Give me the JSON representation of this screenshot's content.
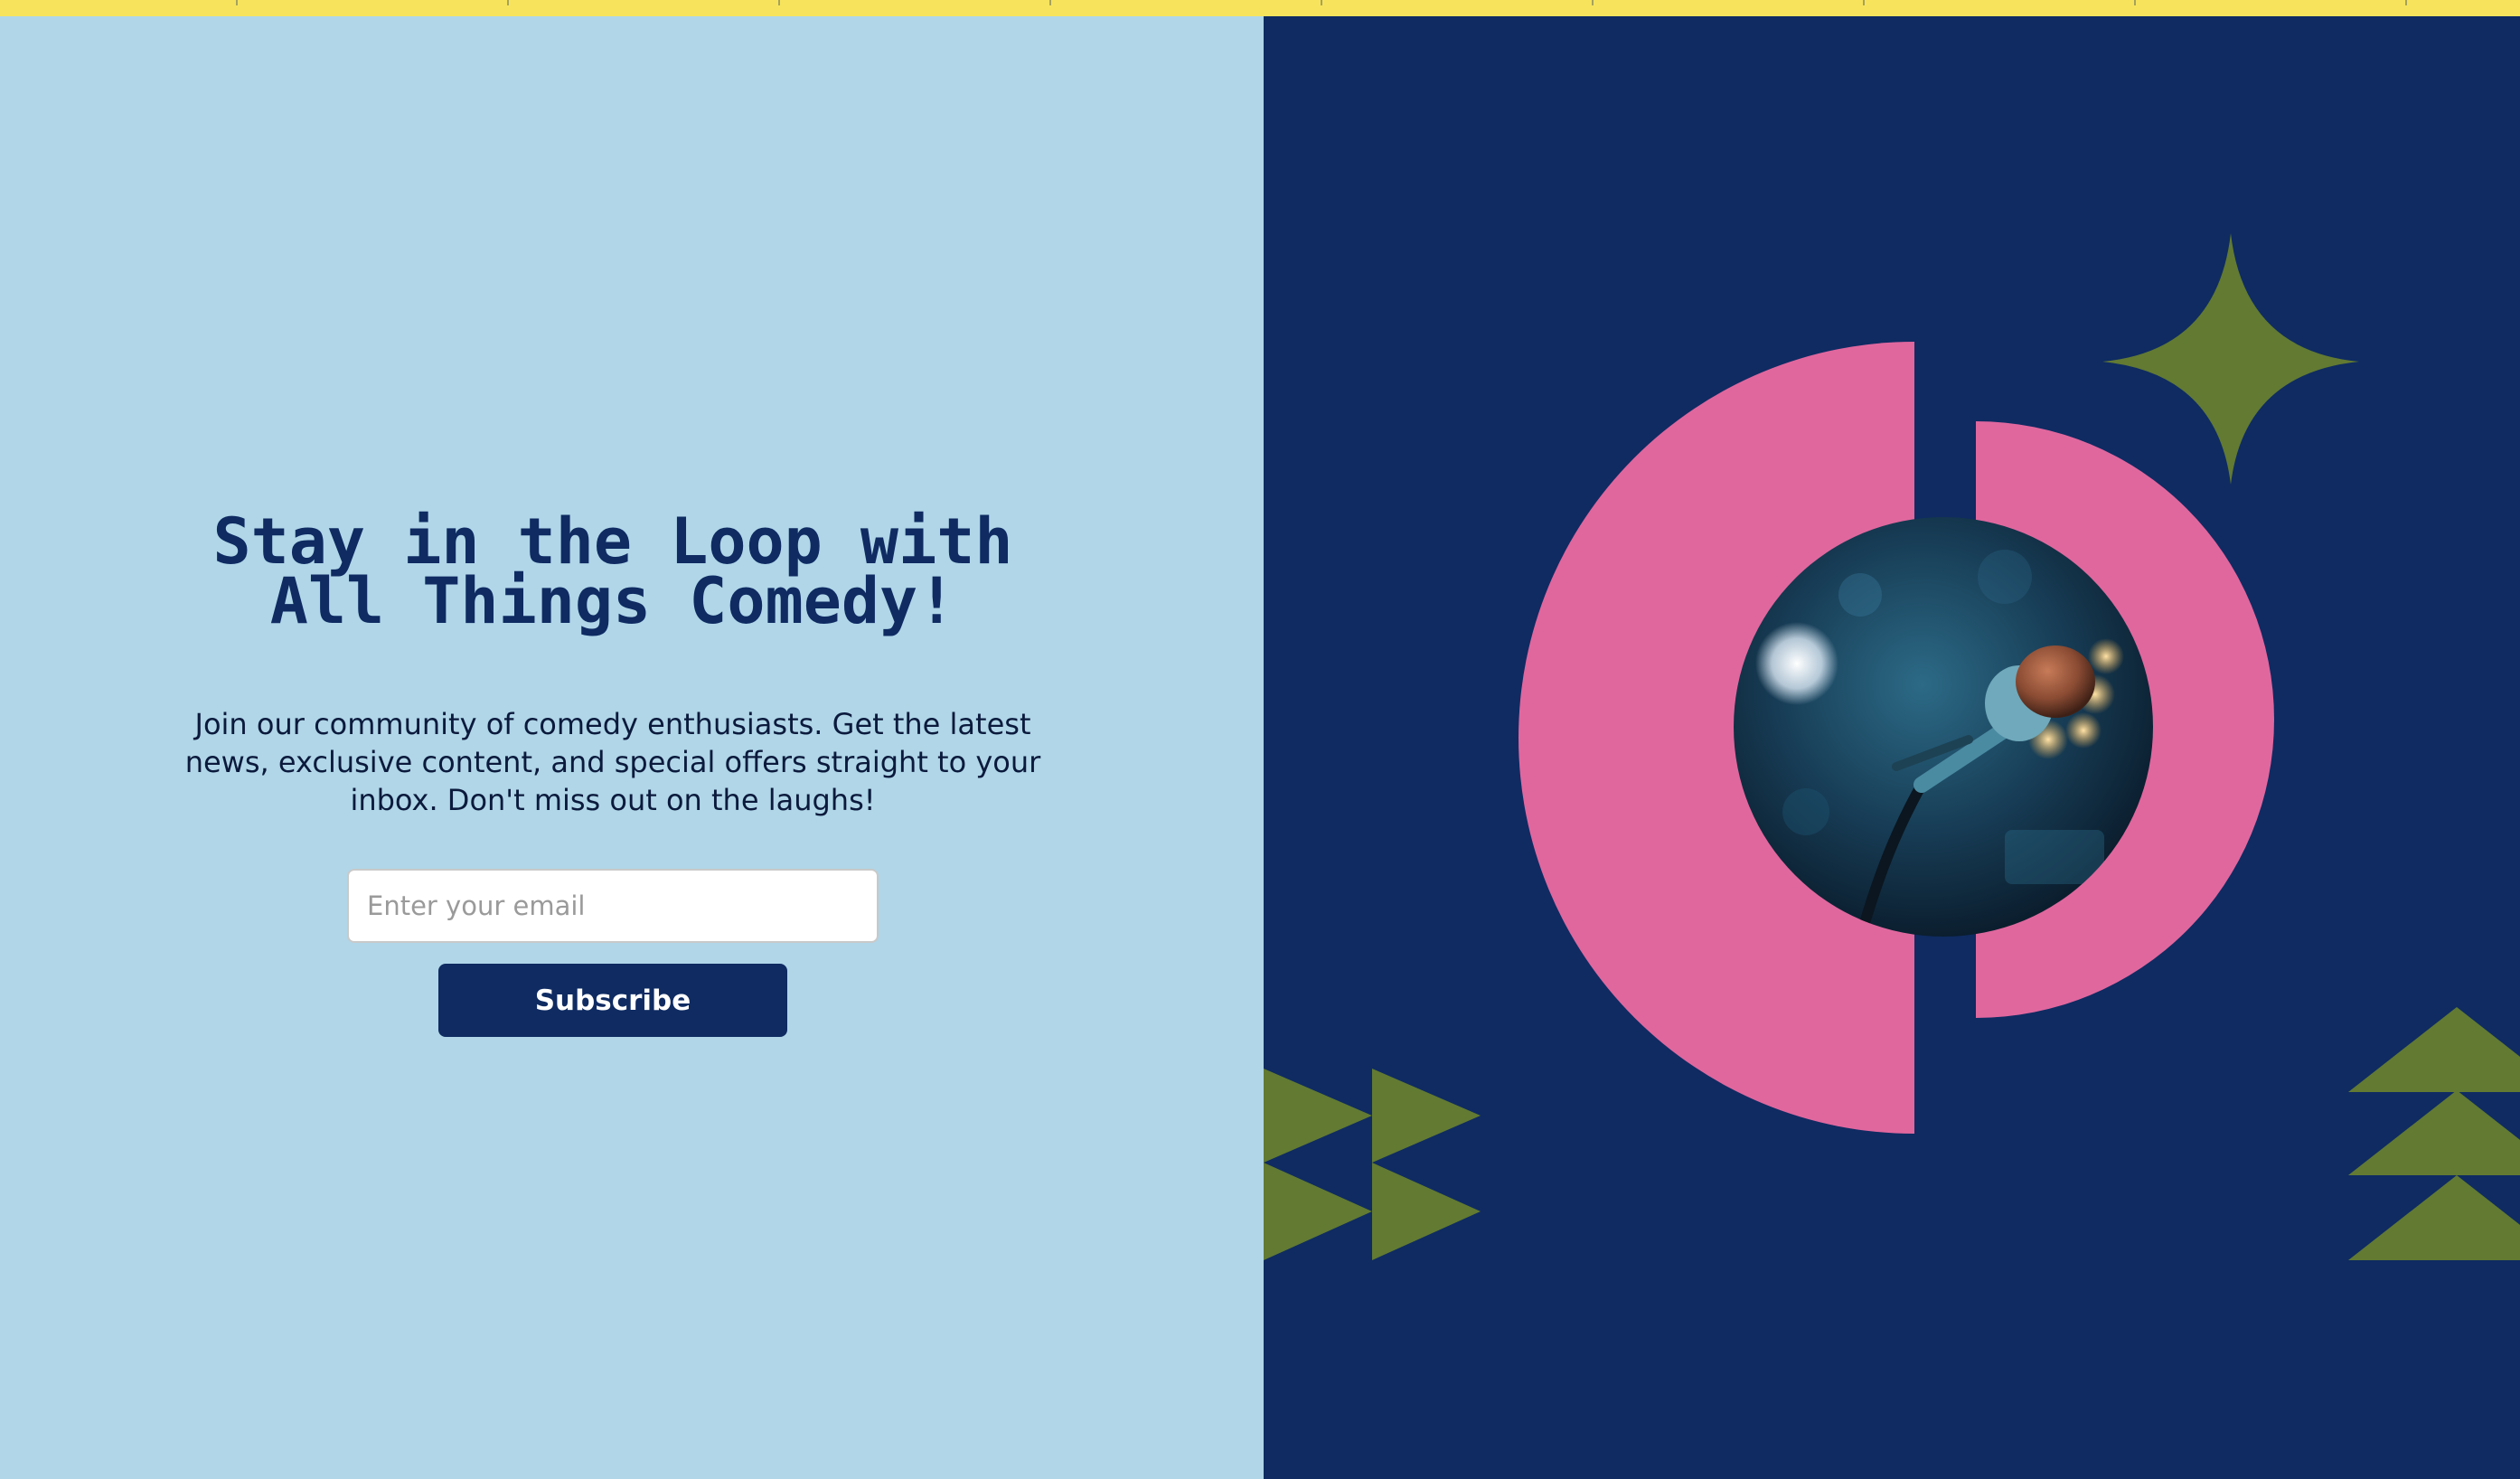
{
  "newsletter": {
    "headline_line1": "Stay in the Loop with",
    "headline_line2": "All Things Comedy!",
    "description_line1": "Join our community of comedy enthusiasts. Get the latest",
    "description_line2": "news, exclusive content, and special offers straight to your",
    "description_line3": "inbox. Don't miss out on the laughs!",
    "email_placeholder": "Enter your email",
    "email_value": "",
    "subscribe_label": "Subscribe"
  },
  "illustration": {
    "photo_subject": "microphone on stage",
    "icons": [
      "split-circle-graphic",
      "sparkle-star-icon",
      "triangle-arrows-icon",
      "stacked-triangles-icon"
    ]
  },
  "colors": {
    "top_strip": "#f7e45c",
    "left_background": "#b0d6e8",
    "right_background": "#0f2b62",
    "primary_navy": "#0f2b62",
    "accent_pink": "#e0679e",
    "accent_green": "#627a32"
  }
}
